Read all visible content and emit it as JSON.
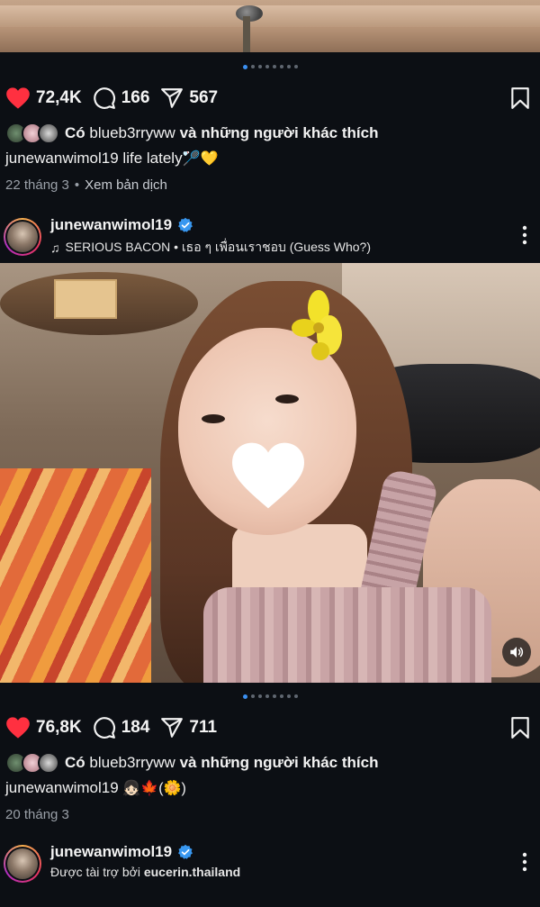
{
  "post1": {
    "likes": "72,4K",
    "comments": "166",
    "shares": "567",
    "liked_by_prefix": "Có",
    "liked_by_user": "blueb3rryww",
    "liked_by_suffix": "và những người khác thích",
    "caption_user": "junewanwimol19",
    "caption_text": "life lately",
    "caption_emoji": "🏸💛",
    "date": "22 tháng 3",
    "translate_label": "Xem bản dịch"
  },
  "post2": {
    "username": "junewanwimol19",
    "music_label": "SERIOUS BACON • เธอ ๆ เพื่อนเราชอบ (Guess Who?)",
    "likes": "76,8K",
    "comments": "184",
    "shares": "711",
    "liked_by_prefix": "Có",
    "liked_by_user": "blueb3rryww",
    "liked_by_suffix": "và những người khác thích",
    "caption_user": "junewanwimol19",
    "caption_emoji": "👧🏻🍁(🌼)",
    "date": "20 tháng 3"
  },
  "post3": {
    "username": "junewanwimol19",
    "sponsored_prefix": "Được tài trợ bởi",
    "sponsor": "eucerin.thailand"
  },
  "icons": {
    "like": "heart-filled-icon",
    "comment": "comment-bubble-icon",
    "share": "send-paper-plane-icon",
    "save": "bookmark-icon",
    "more": "more-vertical-icon",
    "verified": "verified-badge-icon",
    "music": "music-note-icon",
    "volume": "volume-icon"
  },
  "colors": {
    "background": "#0c0f14",
    "like_red": "#ff3040",
    "verified_blue": "#3897f0",
    "carousel_active": "#3b8ff0"
  },
  "carousel": {
    "count": 8,
    "active_index": 0
  }
}
